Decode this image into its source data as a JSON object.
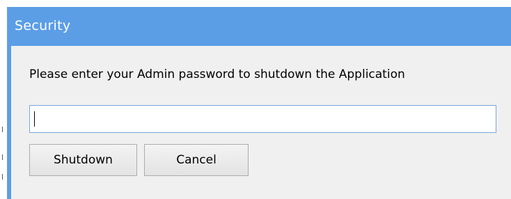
{
  "dialog": {
    "title": "Security",
    "prompt": "Please enter your Admin password to shutdown the Application",
    "password_value": "",
    "shutdown_label": "Shutdown",
    "cancel_label": "Cancel"
  },
  "colors": {
    "titlebar": "#5b9ee6",
    "dialog_bg": "#f0f0f0",
    "input_border": "#7aa7d9"
  }
}
